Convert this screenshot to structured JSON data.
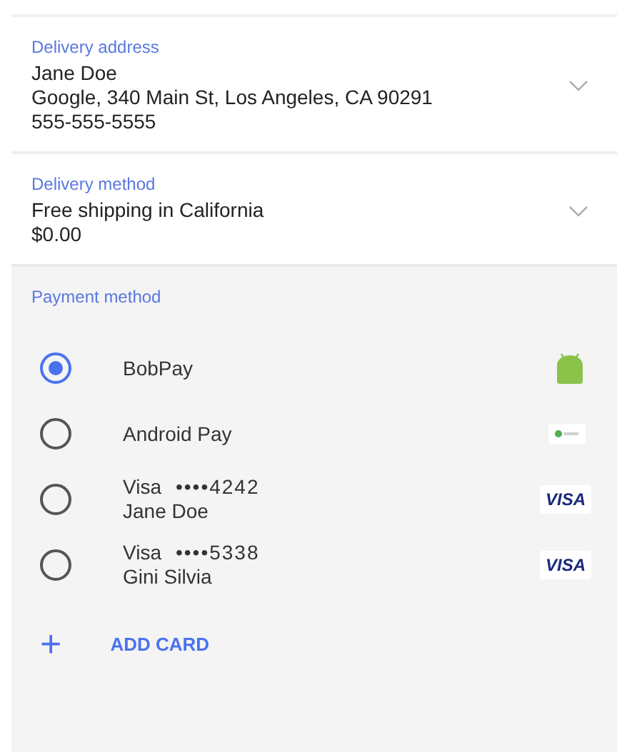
{
  "sections": [
    {
      "label": "Delivery address",
      "lines": [
        "Jane Doe",
        "Google, 340 Main St, Los Angeles, CA 90291",
        "555-555-5555"
      ]
    },
    {
      "label": "Delivery method",
      "lines": [
        "Free shipping in California",
        "$0.00"
      ]
    }
  ],
  "payment": {
    "label": "Payment method",
    "options": [
      {
        "kind": "android",
        "title": "BobPay",
        "selected": true
      },
      {
        "kind": "pay",
        "title": "Android Pay",
        "selected": false
      },
      {
        "kind": "visa",
        "title": "Visa",
        "masked": "••••4242",
        "holder": "Jane Doe",
        "logo": "VISA",
        "selected": false
      },
      {
        "kind": "visa",
        "title": "Visa",
        "masked": "••••5338",
        "holder": "Gini Silvia",
        "logo": "VISA",
        "selected": false
      }
    ],
    "add": {
      "icon": "+",
      "label": "ADD CARD"
    }
  }
}
